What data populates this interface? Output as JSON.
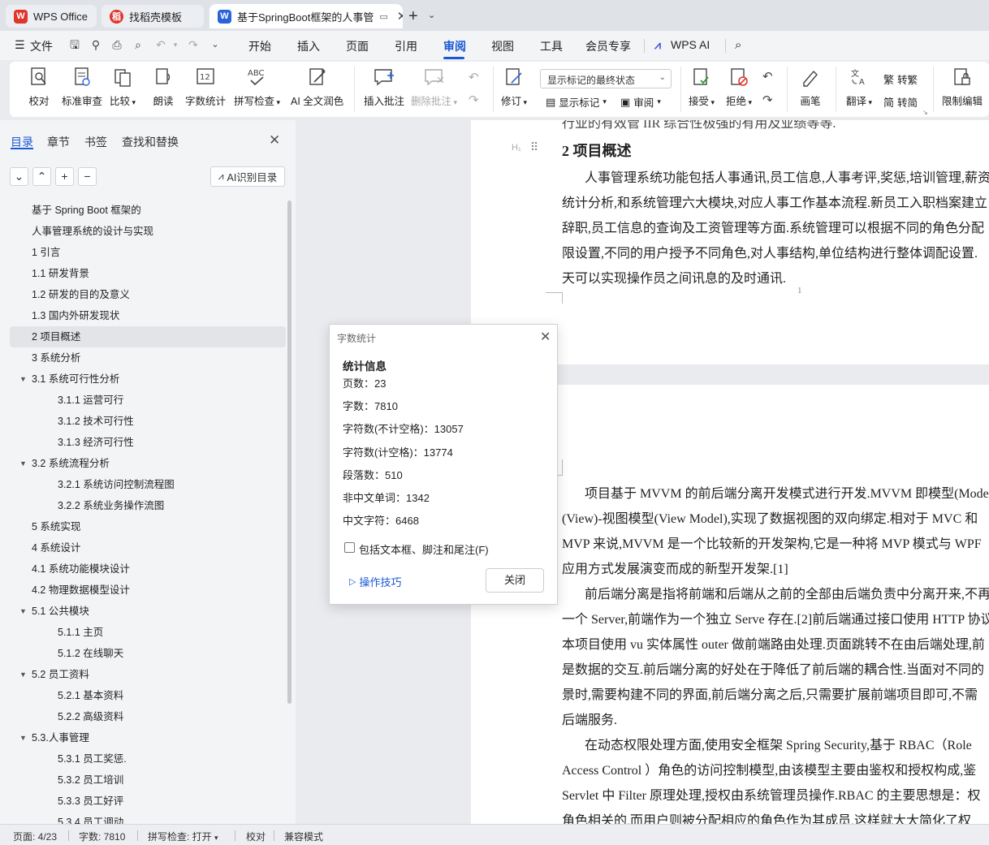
{
  "titlebar": {
    "tabs": [
      {
        "label": "WPS Office",
        "icon": "wps-logo-icon"
      },
      {
        "label": "找稻壳模板",
        "icon": "docer-logo-icon"
      },
      {
        "label": "基于SpringBoot框架的人事管",
        "icon": "word-doc-icon"
      }
    ]
  },
  "menu": {
    "file": "文件",
    "items": [
      "开始",
      "插入",
      "页面",
      "引用",
      "审阅",
      "视图",
      "工具",
      "会员专享"
    ],
    "selected": "审阅",
    "wps_ai": "WPS AI"
  },
  "ribbon": {
    "proofread": "校对",
    "std_review": "标准审查",
    "compare": "比较",
    "read_aloud": "朗读",
    "word_count": "字数统计",
    "spell_check": "拼写检查",
    "ai_polish": "AI 全文润色",
    "insert_comment": "插入批注",
    "delete_comment": "删除批注",
    "track": "修订",
    "markup_mode": "显示标记的最终状态",
    "show_markup": "显示标记",
    "review": "审阅",
    "accept": "接受",
    "reject": "拒绝",
    "pen": "画笔",
    "translate": "翻译",
    "to_traditional": "转繁",
    "to_simplified": "转简",
    "restrict_edit": "限制编辑"
  },
  "nav": {
    "tabs": [
      "目录",
      "章节",
      "书签",
      "查找和替换"
    ],
    "ai_toc": "AI识别目录",
    "toc": [
      {
        "label": "基于 Spring Boot 框架的",
        "level": 1,
        "arrow": false
      },
      {
        "label": "人事管理系统的设计与实现",
        "level": 1,
        "arrow": false
      },
      {
        "label": "1 引言",
        "level": 1,
        "arrow": false
      },
      {
        "label": "1.1 研发背景",
        "level": 1,
        "arrow": false
      },
      {
        "label": "1.2 研发的目的及意义",
        "level": 1,
        "arrow": false
      },
      {
        "label": "1.3 国内外研发现状",
        "level": 1,
        "arrow": false
      },
      {
        "label": "2 项目概述",
        "level": 1,
        "arrow": false,
        "active": true
      },
      {
        "label": "3 系统分析",
        "level": 1,
        "arrow": false
      },
      {
        "label": "3.1 系统可行性分析",
        "level": 1,
        "arrow": true
      },
      {
        "label": "3.1.1 运营可行",
        "level": 2,
        "arrow": false
      },
      {
        "label": "3.1.2 技术可行性",
        "level": 2,
        "arrow": false
      },
      {
        "label": "3.1.3 经济可行性",
        "level": 2,
        "arrow": false
      },
      {
        "label": "3.2 系统流程分析",
        "level": 1,
        "arrow": true
      },
      {
        "label": "3.2.1 系统访问控制流程图",
        "level": 2,
        "arrow": false
      },
      {
        "label": "3.2.2 系统业务操作流图",
        "level": 2,
        "arrow": false
      },
      {
        "label": "5 系统实现",
        "level": 1,
        "arrow": false
      },
      {
        "label": "4 系统设计",
        "level": 1,
        "arrow": false
      },
      {
        "label": "4.1 系统功能模块设计",
        "level": 1,
        "arrow": false
      },
      {
        "label": "4.2 物理数据模型设计",
        "level": 1,
        "arrow": false
      },
      {
        "label": "5.1  公共模块",
        "level": 1,
        "arrow": true
      },
      {
        "label": "5.1.1 主页",
        "level": 2,
        "arrow": false
      },
      {
        "label": "5.1.2 在线聊天",
        "level": 2,
        "arrow": false
      },
      {
        "label": "5.2  员工资料",
        "level": 1,
        "arrow": true
      },
      {
        "label": "5.2.1 基本资料",
        "level": 2,
        "arrow": false
      },
      {
        "label": "5.2.2  高级资料",
        "level": 2,
        "arrow": false
      },
      {
        "label": "5.3.人事管理",
        "level": 1,
        "arrow": true
      },
      {
        "label": "5.3.1 员工奖惩.",
        "level": 2,
        "arrow": false
      },
      {
        "label": "5.3.2 员工培训",
        "level": 2,
        "arrow": false
      },
      {
        "label": "5.3.3 员工好评",
        "level": 2,
        "arrow": false
      },
      {
        "label": "5.3.4 员工调动",
        "level": 2,
        "arrow": false
      }
    ]
  },
  "document": {
    "top_partial": "行业的有效管 IIR 综合性极强的有用及业绩等等.",
    "heading": "2 项目概述",
    "page1_lines": [
      "人事管理系统功能包括人事通讯,员工信息,人事考评,奖惩,培训管理,薪资",
      "统计分析,和系统管理六大模块,对应人事工作基本流程.新员工入职档案建立",
      "辞职,员工信息的查询及工资管理等方面.系统管理可以根据不同的角色分配",
      "限设置,不同的用户授予不同角色,对人事结构,单位结构进行整体调配设置.",
      "天可以实现操作员之间讯息的及时通讯."
    ],
    "page_number": "1",
    "page2_lines": [
      "项目基于 MVVM 的前后端分离开发模式进行开发.MVVM 即模型(Mode",
      "(View)-视图模型(View Model),实现了数据视图的双向绑定.相对于 MVC 和",
      "MVP 来说,MVVM 是一个比较新的开发架构,它是一种将 MVP 模式与 WPF",
      "应用方式发展演变而成的新型开发架.[1]",
      "前后端分离是指将前端和后端从之前的全部由后端负责中分离开来,不再",
      "一个 Server,前端作为一个独立 Serve 存在.[2]前后端通过接口使用 HTTP 协议",
      "本项目使用 vu 实体属性 outer 做前端路由处理.页面跳转不在由后端处理,前",
      "是数据的交互.前后端分离的好处在于降低了前后端的耦合性.当面对不同的",
      "景时,需要构建不同的界面,前后端分离之后,只需要扩展前端项目即可,不需",
      "后端服务.",
      "在动态权限处理方面,使用安全框架 Spring Security,基于 RBAC（Role",
      "Access Control ）角色的访问控制模型,由该模型主要由鉴权和授权构成,鉴",
      "Servlet 中 Filter 原理处理,授权由系统管理员操作.RBAC 的主要思想是：权",
      "角色相关的,而用户则被分配相应的角色作为其成员,这样就大大简化了权"
    ]
  },
  "dialog": {
    "title": "字数统计",
    "heading": "统计信息",
    "stats": [
      "页数：23",
      "字数：7810",
      "字符数(不计空格)：13057",
      "字符数(计空格)：13774",
      "段落数：510",
      "非中文单词：1342",
      "中文字符：6468"
    ],
    "checkbox_label": "包括文本框、脚注和尾注(F)",
    "tips": "操作技巧",
    "close": "关闭"
  },
  "status": {
    "page": "页面: 4/23",
    "words": "字数: 7810",
    "spell": "拼写检查: 打开",
    "proof": "校对",
    "compat": "兼容模式"
  },
  "colors": {
    "accent": "#1a59d6",
    "wps_red": "#e0352b",
    "word_blue": "#2b64d9"
  }
}
